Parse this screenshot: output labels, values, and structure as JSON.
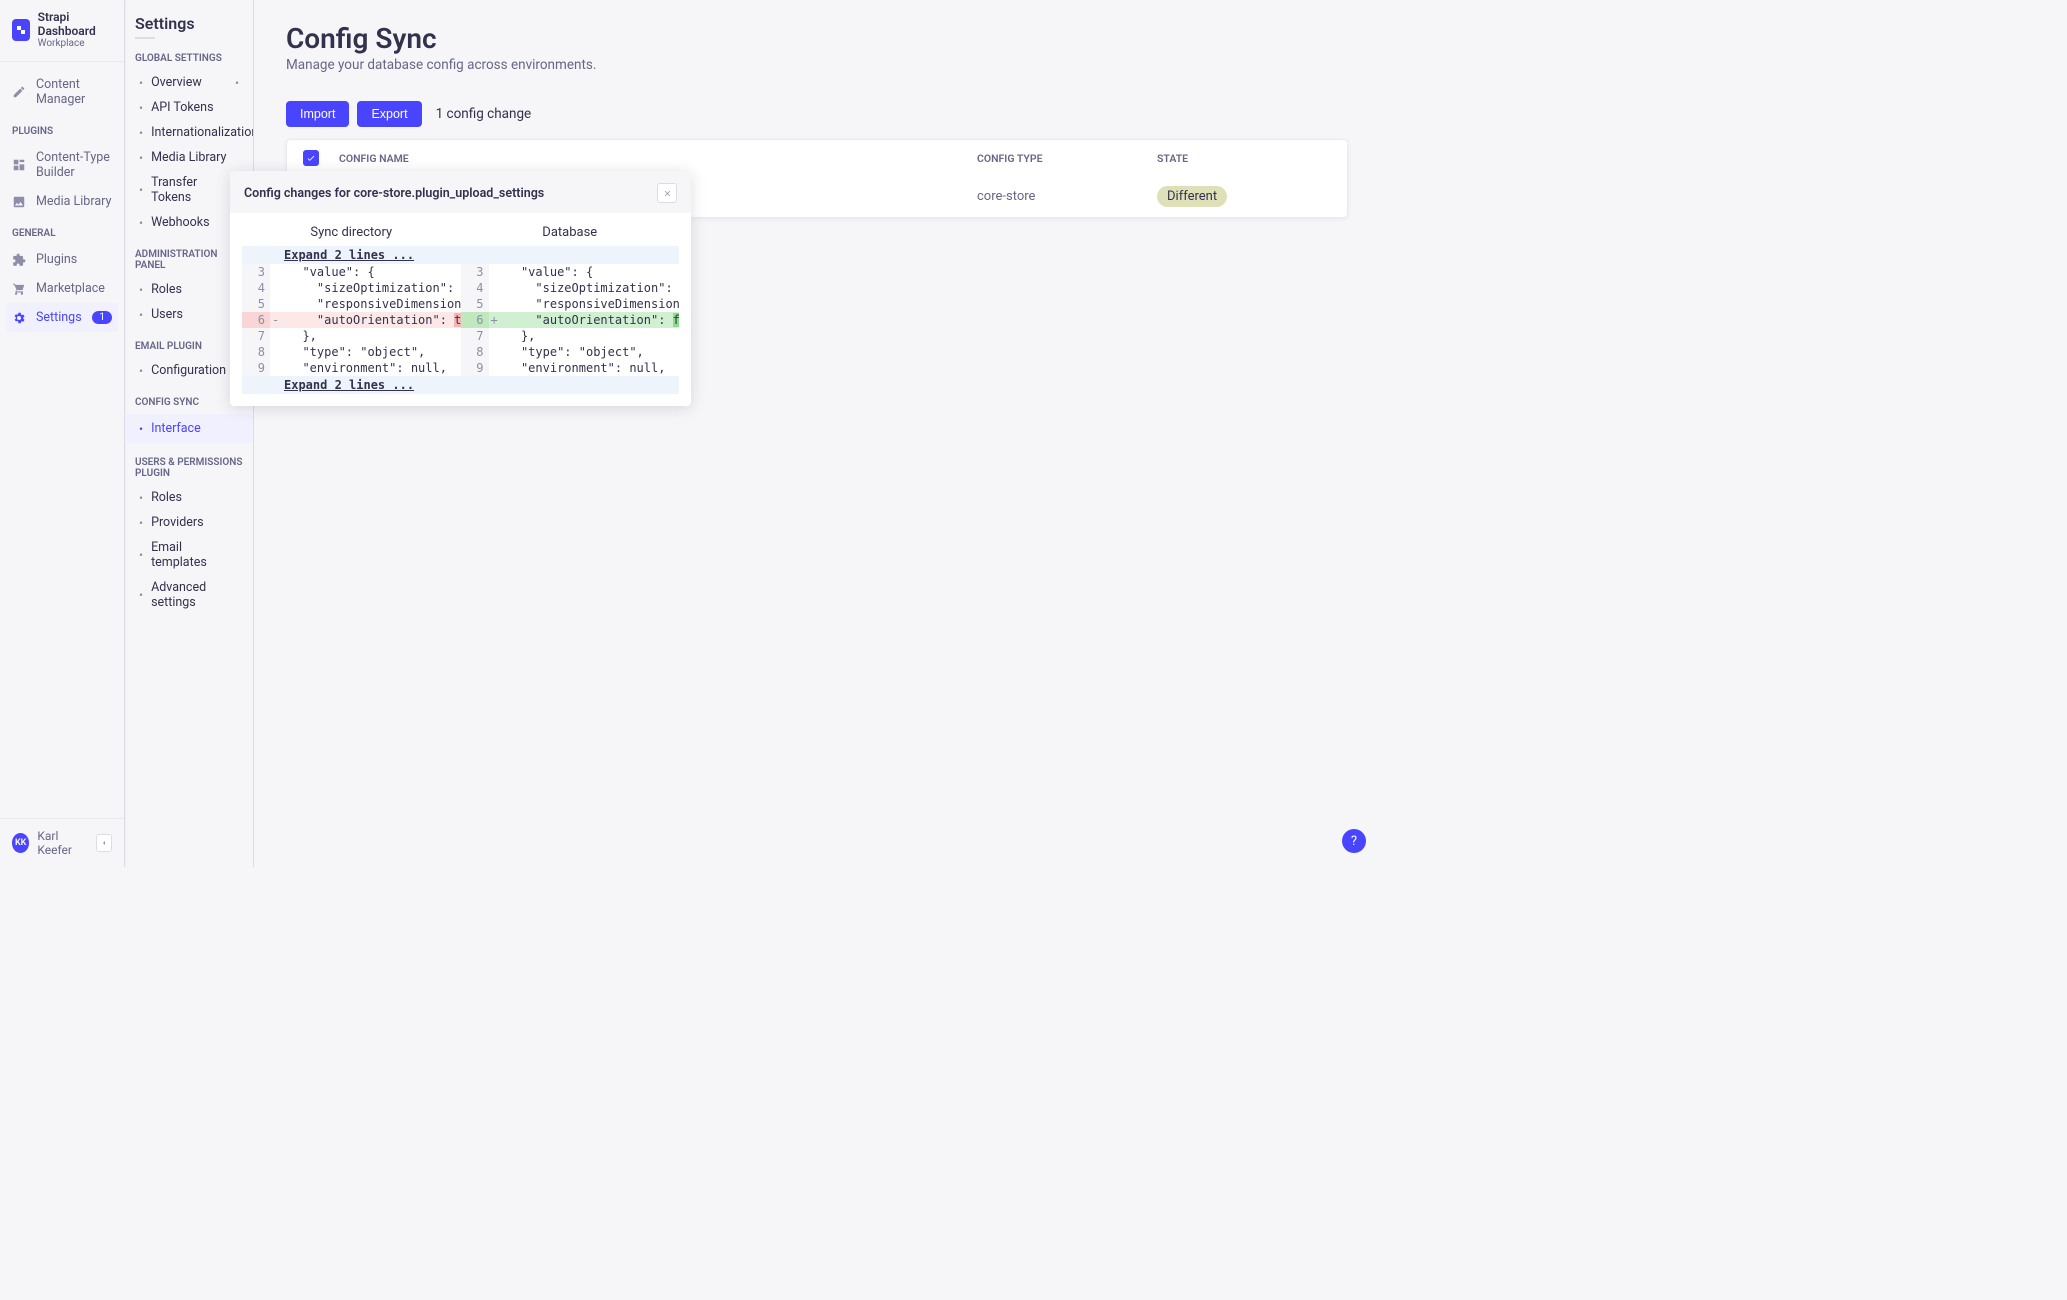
{
  "brand": {
    "title": "Strapi Dashboard",
    "subtitle": "Workplace"
  },
  "primaryNav": {
    "contentManager": "Content Manager",
    "sections": {
      "plugins": {
        "label": "Plugins",
        "items": {
          "ctb": "Content-Type Builder",
          "media": "Media Library"
        }
      },
      "general": {
        "label": "General",
        "items": {
          "plugins": "Plugins",
          "marketplace": "Marketplace",
          "settings": "Settings",
          "settingsBadge": "1"
        }
      }
    }
  },
  "user": {
    "initials": "KK",
    "name": "Karl Keefer"
  },
  "subNav": {
    "title": "Settings",
    "sections": [
      {
        "label": "Global Settings",
        "items": [
          {
            "label": "Overview",
            "rightDot": true
          },
          {
            "label": "API Tokens"
          },
          {
            "label": "Internationalization"
          },
          {
            "label": "Media Library"
          },
          {
            "label": "Transfer Tokens"
          },
          {
            "label": "Webhooks"
          }
        ]
      },
      {
        "label": "Administration Panel",
        "items": [
          {
            "label": "Roles"
          },
          {
            "label": "Users"
          }
        ]
      },
      {
        "label": "Email Plugin",
        "items": [
          {
            "label": "Configuration"
          }
        ]
      },
      {
        "label": "Config Sync",
        "items": [
          {
            "label": "Interface",
            "active": true
          }
        ]
      },
      {
        "label": "Users & Permissions plugin",
        "items": [
          {
            "label": "Roles"
          },
          {
            "label": "Providers"
          },
          {
            "label": "Email templates"
          },
          {
            "label": "Advanced settings"
          }
        ]
      }
    ]
  },
  "page": {
    "title": "Config Sync",
    "desc": "Manage your database config across environments.",
    "importLabel": "Import",
    "exportLabel": "Export",
    "changeCount": "1 config change"
  },
  "table": {
    "headers": {
      "name": "Config Name",
      "type": "Config Type",
      "state": "State"
    },
    "rows": [
      {
        "name": "plugin_upload_settings",
        "type": "core-store",
        "state": "Different"
      }
    ]
  },
  "modal": {
    "title": "Config changes for core-store.plugin_upload_settings",
    "leftHeader": "Sync directory",
    "rightHeader": "Database",
    "expandTop": "Expand 2 lines ...",
    "expandBottom": "Expand 2 lines ...",
    "diff": [
      {
        "ln": 3,
        "rn": 3,
        "l": "  \"value\": {",
        "r": "  \"value\": {"
      },
      {
        "ln": 4,
        "rn": 4,
        "l": "    \"sizeOptimization\": true,",
        "r": "    \"sizeOptimization\": true,"
      },
      {
        "ln": 5,
        "rn": 5,
        "l": "    \"responsiveDimensions\": true,",
        "r": "    \"responsiveDimensions\": true,"
      },
      {
        "ln": 6,
        "rn": 6,
        "lPre": "    \"autoOrientation\": ",
        "lHi": "true",
        "rPre": "    \"autoOrientation\": ",
        "rHi": "false",
        "changed": true
      },
      {
        "ln": 7,
        "rn": 7,
        "l": "  },",
        "r": "  },"
      },
      {
        "ln": 8,
        "rn": 8,
        "l": "  \"type\": \"object\",",
        "r": "  \"type\": \"object\","
      },
      {
        "ln": 9,
        "rn": 9,
        "l": "  \"environment\": null,",
        "r": "  \"environment\": null,"
      }
    ]
  },
  "help": "?"
}
